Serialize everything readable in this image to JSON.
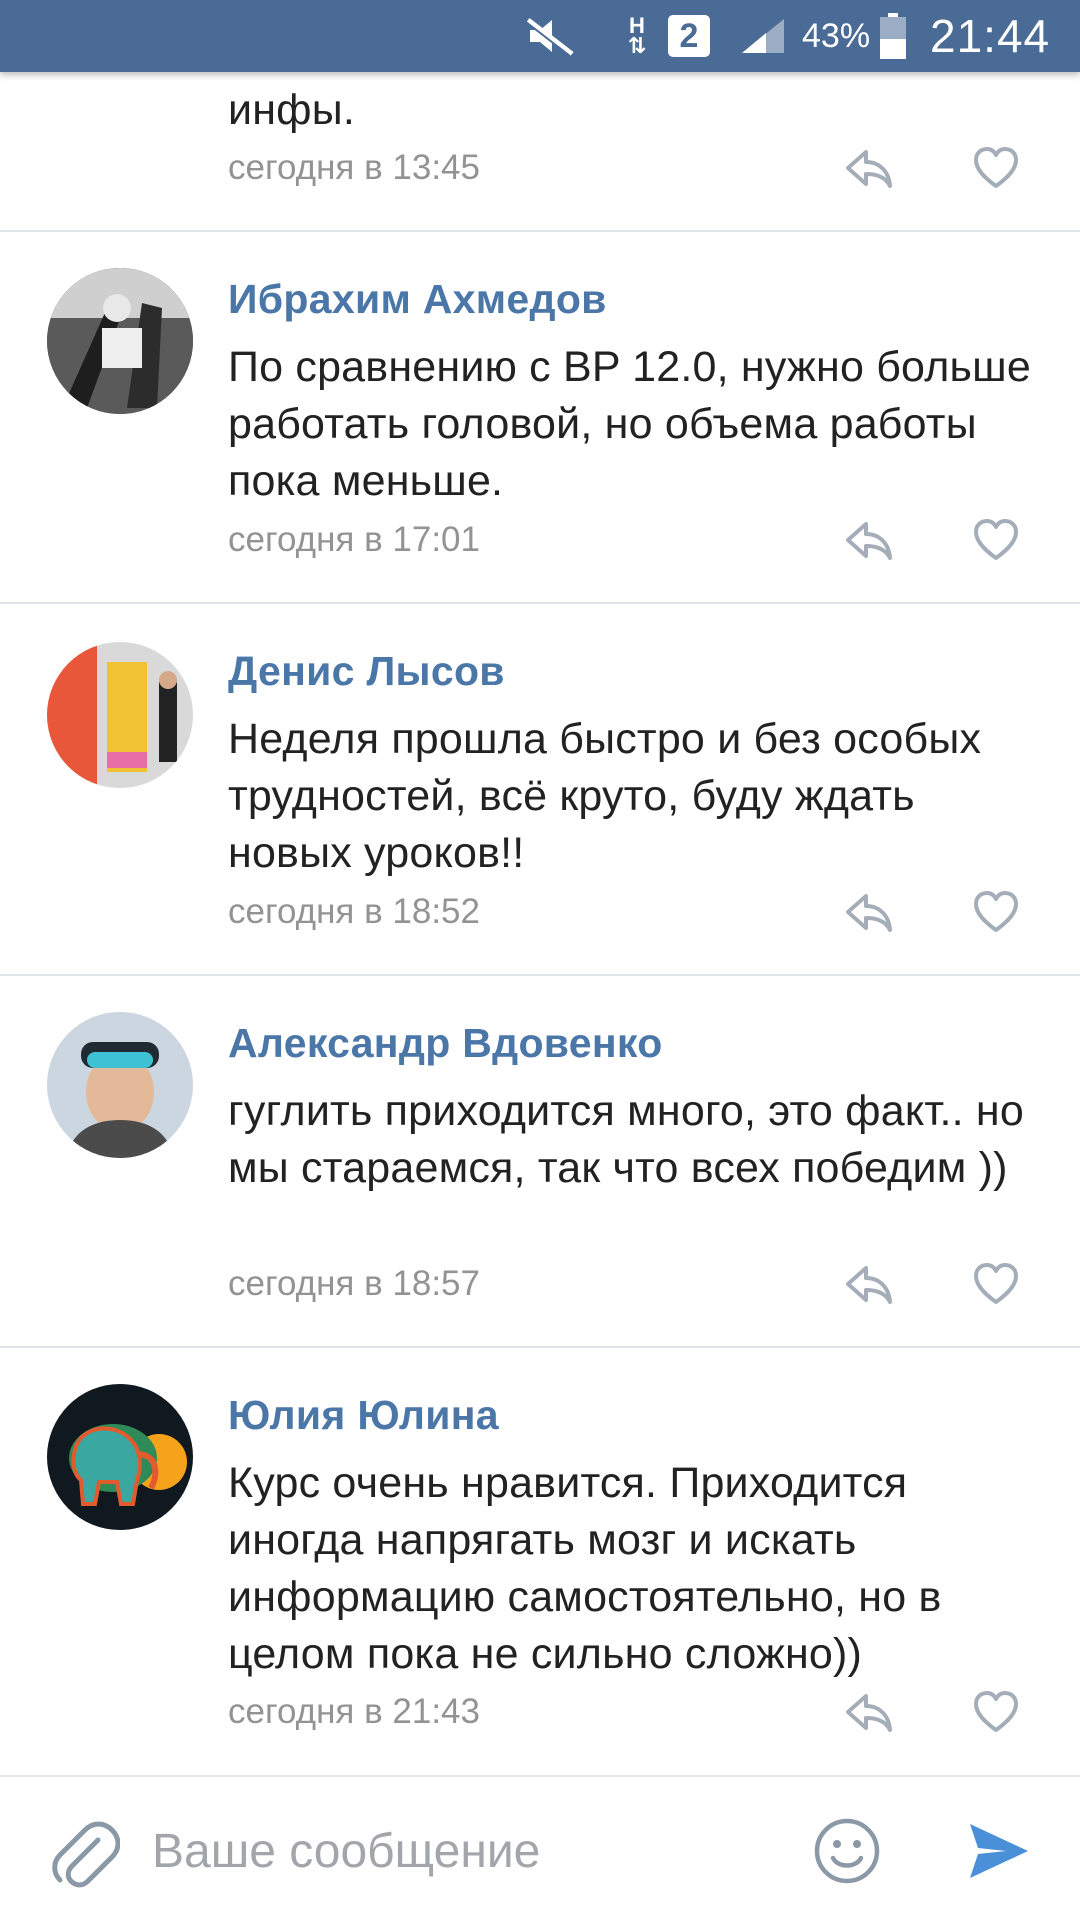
{
  "status_bar": {
    "network": "H",
    "sim_slot": "2",
    "battery_percent": "43%",
    "time": "21:44",
    "color": "#4a6b96"
  },
  "comments": [
    {
      "author": "",
      "text": "инфы.",
      "time": "сегодня в 13:45"
    },
    {
      "author": "Ибрахим Ахмедов",
      "text": "По сравнению с BP 12.0, нужно больше работать головой, но объема работы пока меньше.",
      "time": "сегодня в 17:01",
      "avatar_icon": "avatar-photo"
    },
    {
      "author": "Денис Лысов",
      "text": "Неделя прошла быстро и без особых трудностей, всё круто, буду ждать новых уроков!!",
      "time": "сегодня в 18:52",
      "avatar_icon": "avatar-photo"
    },
    {
      "author": "Александр Вдовенко",
      "text": "гуглить приходится много, это факт.. но мы стараемся, так что всех победим ))",
      "time": "сегодня в 18:57",
      "avatar_icon": "avatar-photo"
    },
    {
      "author": "Юлия Юлина",
      "text": "Курс очень нравится. Приходится иногда напрягать мозг и искать информацию самостоятельно, но в целом пока не сильно сложно))",
      "time": "сегодня в 21:43",
      "avatar_icon": "avatar-photo"
    }
  ],
  "composer": {
    "placeholder": "Ваше сообщение",
    "value": "",
    "accent": "#4a76a8"
  },
  "colors": {
    "author": "#4a76a8",
    "meta": "#939393",
    "text": "#222222",
    "divider": "#e1e4e8"
  }
}
